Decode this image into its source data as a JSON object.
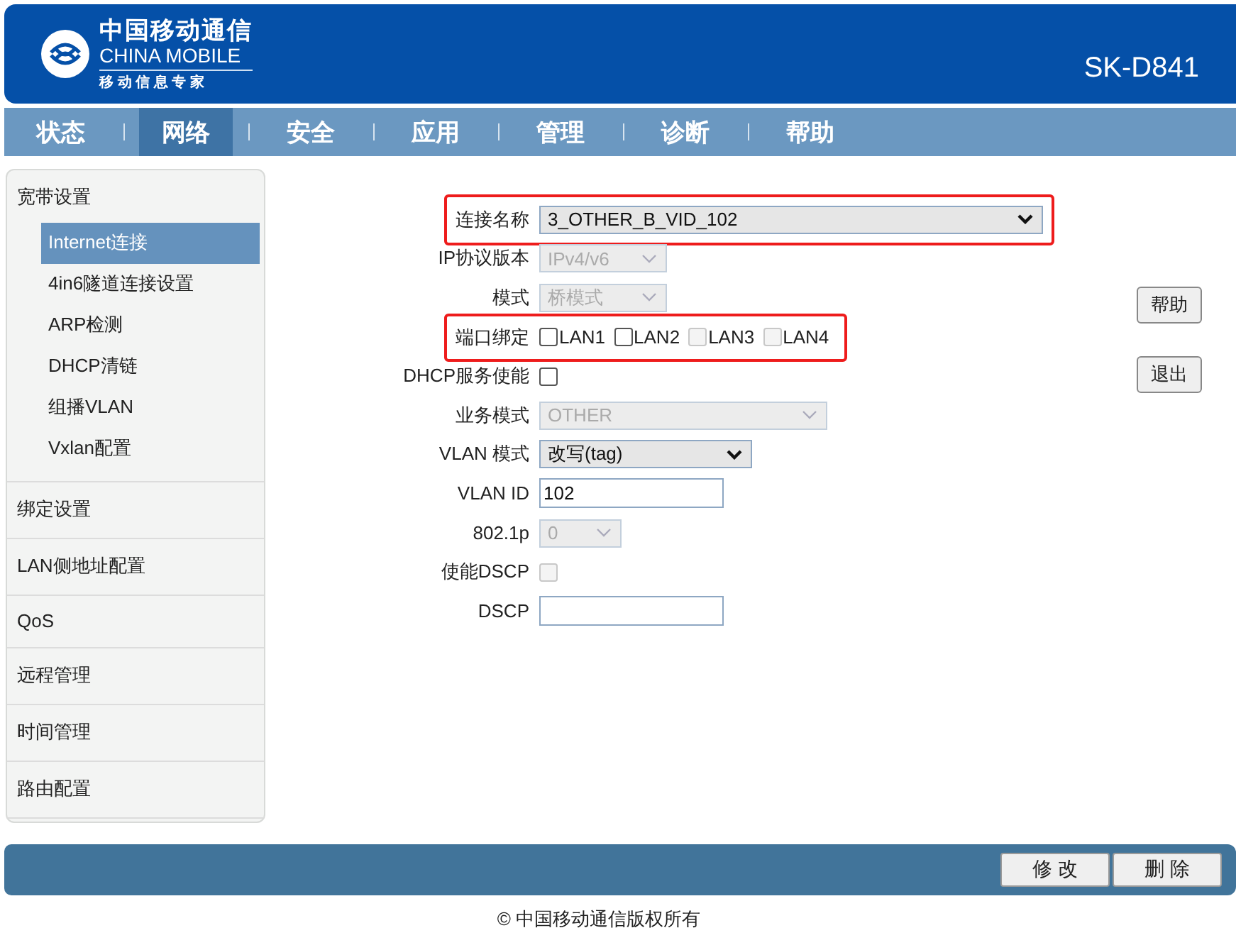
{
  "header": {
    "brand_cn": "中国移动通信",
    "brand_en": "CHINA MOBILE",
    "slogan": "移 动 信 息 专 家",
    "model": "SK-D841"
  },
  "nav": [
    {
      "label": "状态",
      "selected": false
    },
    {
      "label": "网络",
      "selected": true
    },
    {
      "label": "安全",
      "selected": false
    },
    {
      "label": "应用",
      "selected": false
    },
    {
      "label": "管理",
      "selected": false
    },
    {
      "label": "诊断",
      "selected": false
    },
    {
      "label": "帮助",
      "selected": false
    }
  ],
  "sidebar": [
    {
      "label": "宽带设置",
      "children": [
        {
          "label": "Internet连接",
          "selected": true
        },
        {
          "label": "4in6隧道连接设置",
          "selected": false
        },
        {
          "label": "ARP检测",
          "selected": false
        },
        {
          "label": "DHCP清链",
          "selected": false
        },
        {
          "label": "组播VLAN",
          "selected": false
        },
        {
          "label": "Vxlan配置",
          "selected": false
        }
      ]
    },
    {
      "label": "绑定设置"
    },
    {
      "label": "LAN侧地址配置"
    },
    {
      "label": "QoS"
    },
    {
      "label": "远程管理"
    },
    {
      "label": "时间管理"
    },
    {
      "label": "路由配置"
    }
  ],
  "form": [
    {
      "kind": "select",
      "label": "连接名称",
      "value": "3_OTHER_B_VID_102",
      "disabled": false,
      "highlighted": true
    },
    {
      "kind": "select",
      "label": "IP协议版本",
      "value": "IPv4/v6",
      "disabled": true,
      "highlighted": false
    },
    {
      "kind": "select",
      "label": "模式",
      "value": "桥模式",
      "disabled": true,
      "highlighted": false
    },
    {
      "kind": "checkboxes",
      "label": "端口绑定",
      "highlighted": true,
      "options": [
        {
          "label": "LAN1",
          "checked": false,
          "disabled": false
        },
        {
          "label": "LAN2",
          "checked": false,
          "disabled": false
        },
        {
          "label": "LAN3",
          "checked": false,
          "disabled": true
        },
        {
          "label": "LAN4",
          "checked": false,
          "disabled": true
        }
      ]
    },
    {
      "kind": "checkbox",
      "label": "DHCP服务使能",
      "checked": false,
      "disabled": false,
      "highlighted": false
    },
    {
      "kind": "select",
      "label": "业务模式",
      "value": "OTHER",
      "disabled": true,
      "highlighted": false
    },
    {
      "kind": "select",
      "label": "VLAN 模式",
      "value": "改写(tag)",
      "disabled": false,
      "highlighted": false
    },
    {
      "kind": "text",
      "label": "VLAN ID",
      "value": "102",
      "highlighted": false
    },
    {
      "kind": "select",
      "label": "802.1p",
      "value": "0",
      "disabled": true,
      "highlighted": false
    },
    {
      "kind": "checkbox",
      "label": "使能DSCP",
      "checked": false,
      "disabled": true,
      "highlighted": false
    },
    {
      "kind": "text",
      "label": "DSCP",
      "highlighted": false
    }
  ],
  "side_buttons": [
    "帮助",
    "退出"
  ],
  "bottom_buttons": [
    "修 改",
    "删 除"
  ],
  "footer": "© 中国移动通信版权所有"
}
